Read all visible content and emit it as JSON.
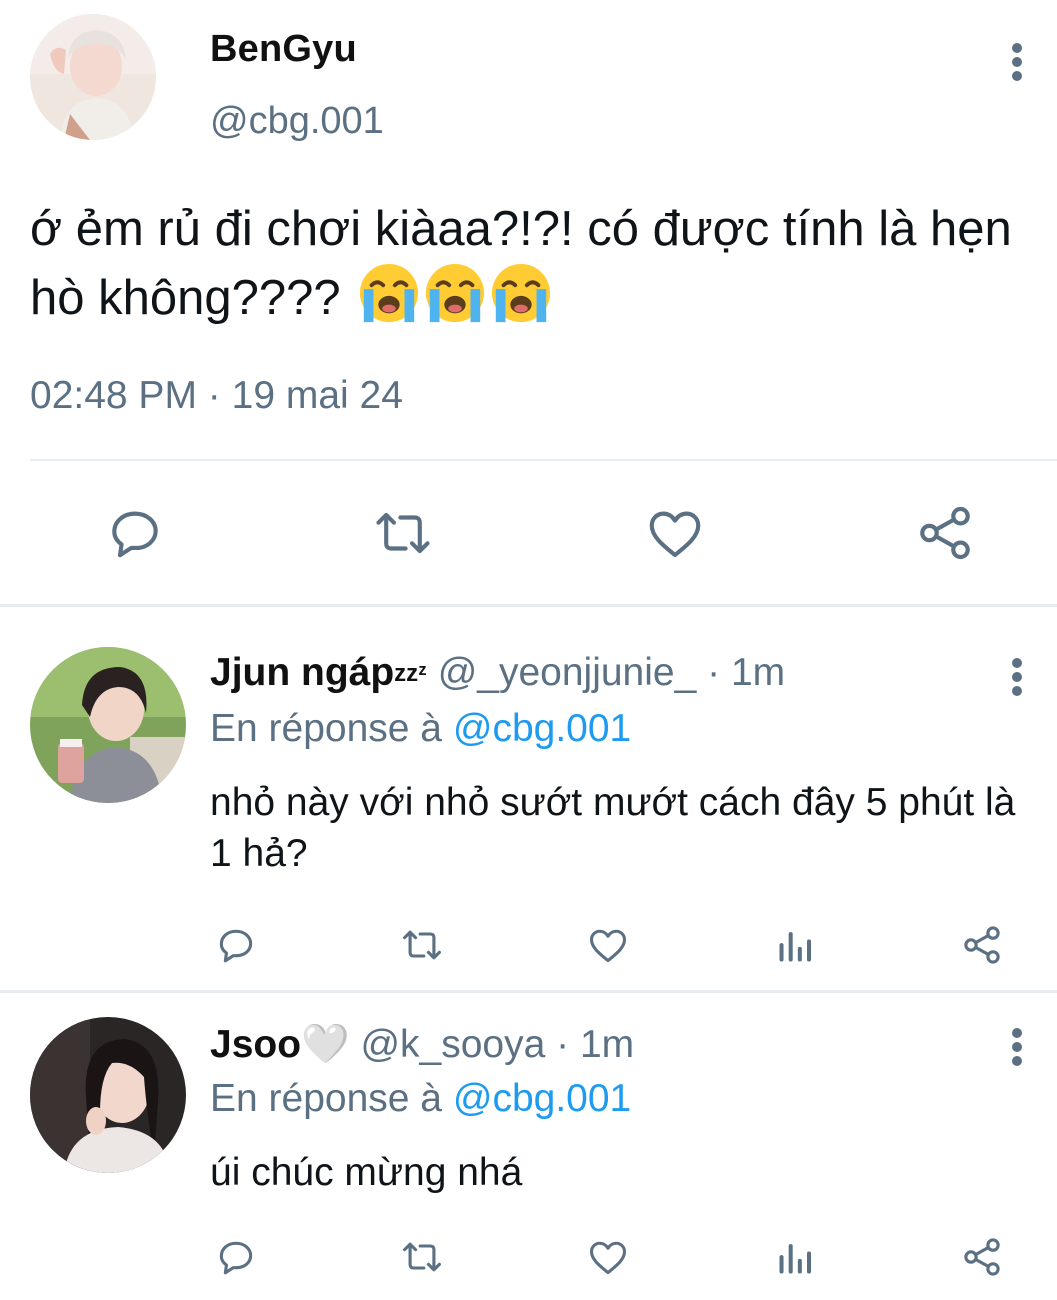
{
  "main_tweet": {
    "author_name": "BenGyu",
    "author_handle": "@cbg.001",
    "text": "ớ ẻm rủ đi chơi kiàaa?!?! có được tính là hẹn hò không????",
    "emoji": [
      "loudly-crying-face",
      "loudly-crying-face",
      "loudly-crying-face"
    ],
    "time": "02:48 PM",
    "dot": "·",
    "date": "19 mai 24",
    "actions": [
      "reply-icon",
      "retweet-icon",
      "like-icon",
      "share-icon"
    ]
  },
  "replies": [
    {
      "author_name": "Jjun ngáp",
      "name_suffix": "zzᶻ",
      "author_handle": "@_yeonjjunie_",
      "dot": "·",
      "time": "1m",
      "in_reply_prefix": "En réponse à",
      "in_reply_handle": "@cbg.001",
      "text": "nhỏ này với nhỏ sướt mướt cách đây 5 phút là 1 hả?",
      "actions": [
        "reply-icon",
        "retweet-icon",
        "like-icon",
        "analytics-icon",
        "share-icon"
      ]
    },
    {
      "author_name": "Jsoo🤍",
      "author_handle": "@k_sooya",
      "dot": "·",
      "time": "1m",
      "in_reply_prefix": "En réponse à",
      "in_reply_handle": "@cbg.001",
      "text": "úi chúc mừng nhá",
      "actions": [
        "reply-icon",
        "retweet-icon",
        "like-icon",
        "analytics-icon",
        "share-icon"
      ]
    }
  ],
  "colors": {
    "text": "#0f1419",
    "secondary": "#5b7083",
    "link": "#1d9bf0",
    "divider": "#e6ecf0"
  }
}
